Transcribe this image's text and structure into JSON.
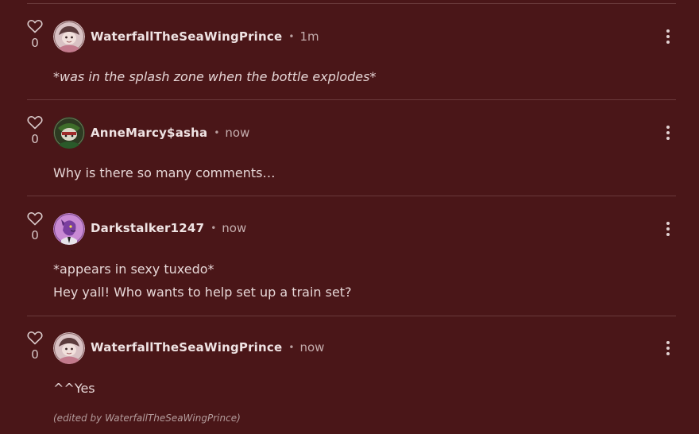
{
  "comments": [
    {
      "likes": "0",
      "username": "WaterfallTheSeaWingPrince",
      "separator": "•",
      "time": "1m",
      "lines": [
        "*was in the splash zone when the bottle explodes*"
      ],
      "avatar_icon": "cartoon-prince-avatar"
    },
    {
      "likes": "0",
      "username": "AnneMarcy$asha",
      "separator": "•",
      "time": "now",
      "lines": [
        "Why is there so many comments…"
      ],
      "avatar_icon": "green-cartoon-avatar"
    },
    {
      "likes": "0",
      "username": "Darkstalker1247",
      "separator": "•",
      "time": "now",
      "lines": [
        "*appears in sexy tuxedo*",
        "Hey yall! Who wants to help set up a train set?"
      ],
      "avatar_icon": "purple-dragon-avatar"
    },
    {
      "likes": "0",
      "username": "WaterfallTheSeaWingPrince",
      "separator": "•",
      "time": "now",
      "lines": [
        "^^Yes"
      ],
      "edited_note": "(edited by WaterfallTheSeaWingPrince)",
      "avatar_icon": "cartoon-prince-avatar"
    }
  ],
  "colors": {
    "background": "#4a1618",
    "divider": "#6a3a3b",
    "text": "#e6d6d6"
  }
}
